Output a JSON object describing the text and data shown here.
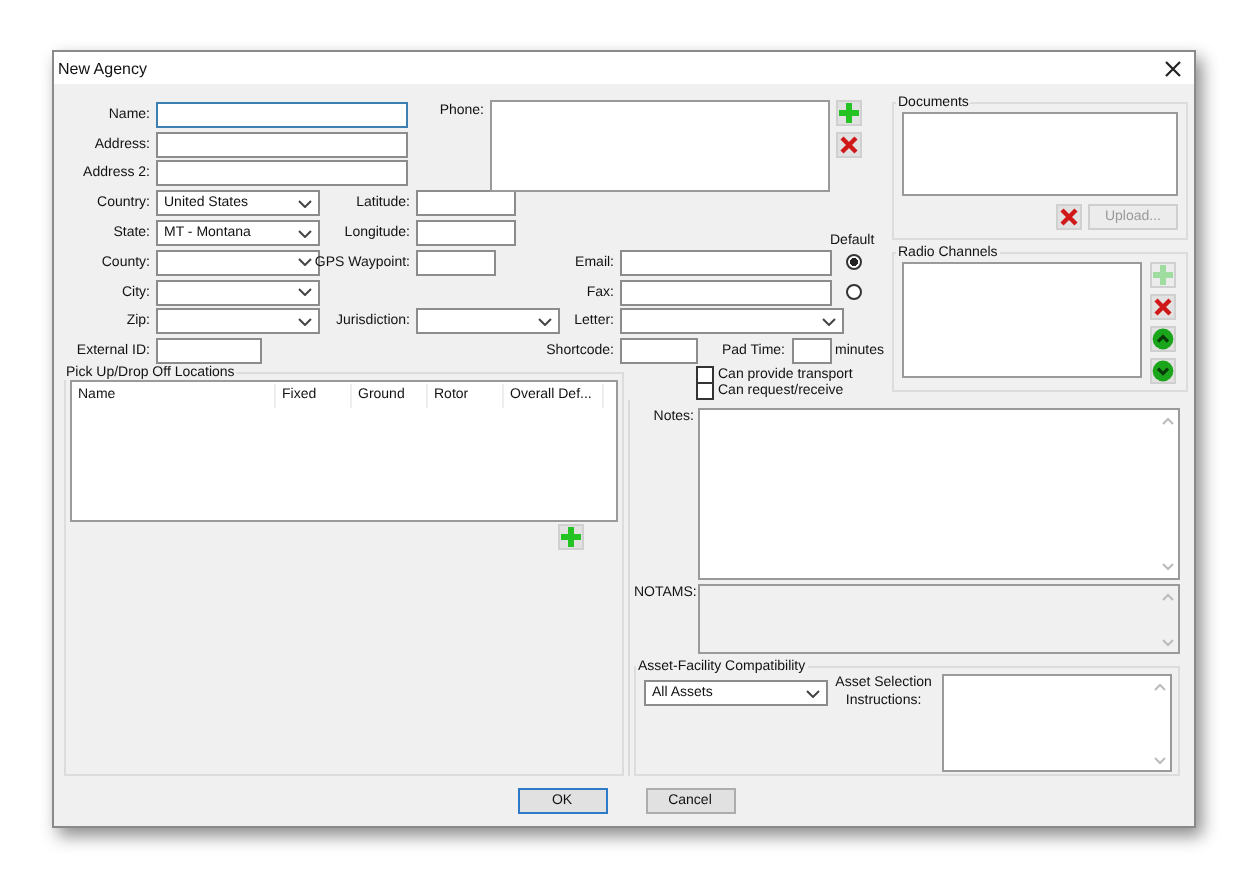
{
  "window": {
    "title": "New Agency"
  },
  "address_fields": [
    {
      "label": "Name:",
      "kind": "text",
      "focused": true
    },
    {
      "label": "Address:",
      "kind": "text",
      "focused": false
    },
    {
      "label": "Address 2:",
      "kind": "text",
      "focused": false
    },
    {
      "label": "Country:",
      "kind": "dropdown",
      "value": "United States",
      "focused": false
    },
    {
      "label": "State:",
      "kind": "dropdown",
      "value": "MT - Montana",
      "focused": false
    },
    {
      "label": "County:",
      "kind": "dropdown",
      "focused": false
    },
    {
      "label": "City:",
      "kind": "dropdown",
      "focused": false
    },
    {
      "label": "Zip:",
      "kind": "dropdown",
      "focused": false
    },
    {
      "label": "External ID:",
      "kind": "short-text",
      "focused": false
    }
  ],
  "location_fields": [
    {
      "label": "Latitude:",
      "kind": "text"
    },
    {
      "label": "Longitude:",
      "kind": "text"
    },
    {
      "label": "GPS Waypoint:",
      "kind": "short-text"
    },
    {
      "label": "Jurisdiction:",
      "kind": "dropdown"
    }
  ],
  "phone": {
    "label": "Phone:",
    "buttons": [
      {
        "kind": "add",
        "disabled": false
      },
      {
        "kind": "delete",
        "disabled": false
      }
    ]
  },
  "contact": {
    "default_label": "Default",
    "fields": [
      {
        "label": "Email:",
        "kind": "text",
        "default_selected": true
      },
      {
        "label": "Fax:",
        "kind": "text",
        "default_selected": false
      },
      {
        "label": "Letter:",
        "kind": "dropdown"
      },
      {
        "label": "Shortcode:",
        "kind": "short-text"
      }
    ],
    "pad_time": {
      "label": "Pad Time:",
      "unit": "minutes"
    }
  },
  "documents": {
    "title": "Documents",
    "buttons": [
      {
        "kind": "delete",
        "disabled": false
      }
    ],
    "upload": {
      "label": "Upload...",
      "disabled": true
    }
  },
  "radio_channels": {
    "title": "Radio Channels",
    "buttons": [
      {
        "kind": "add",
        "disabled": true
      },
      {
        "kind": "delete",
        "disabled": false
      },
      {
        "kind": "up",
        "disabled": false
      },
      {
        "kind": "down",
        "disabled": false
      }
    ]
  },
  "checkboxes": [
    {
      "label": "Can provide transport",
      "checked": false
    },
    {
      "label": "Can request/receive",
      "checked": false
    }
  ],
  "pickup": {
    "title": "Pick Up/Drop Off Locations",
    "columns": [
      "Name",
      "Fixed",
      "Ground",
      "Rotor",
      "Overall Def..."
    ],
    "buttons": [
      {
        "kind": "add",
        "disabled": false
      }
    ]
  },
  "notes": {
    "label": "Notes:",
    "disabled": false
  },
  "notams": {
    "label": "NOTAMS:",
    "disabled": true
  },
  "asset": {
    "title": "Asset-Facility Compatibility",
    "value": "All Assets",
    "instructions_label": "Asset Selection Instructions:"
  },
  "buttons": [
    {
      "label": "OK",
      "default": true
    },
    {
      "label": "Cancel",
      "default": false
    }
  ]
}
